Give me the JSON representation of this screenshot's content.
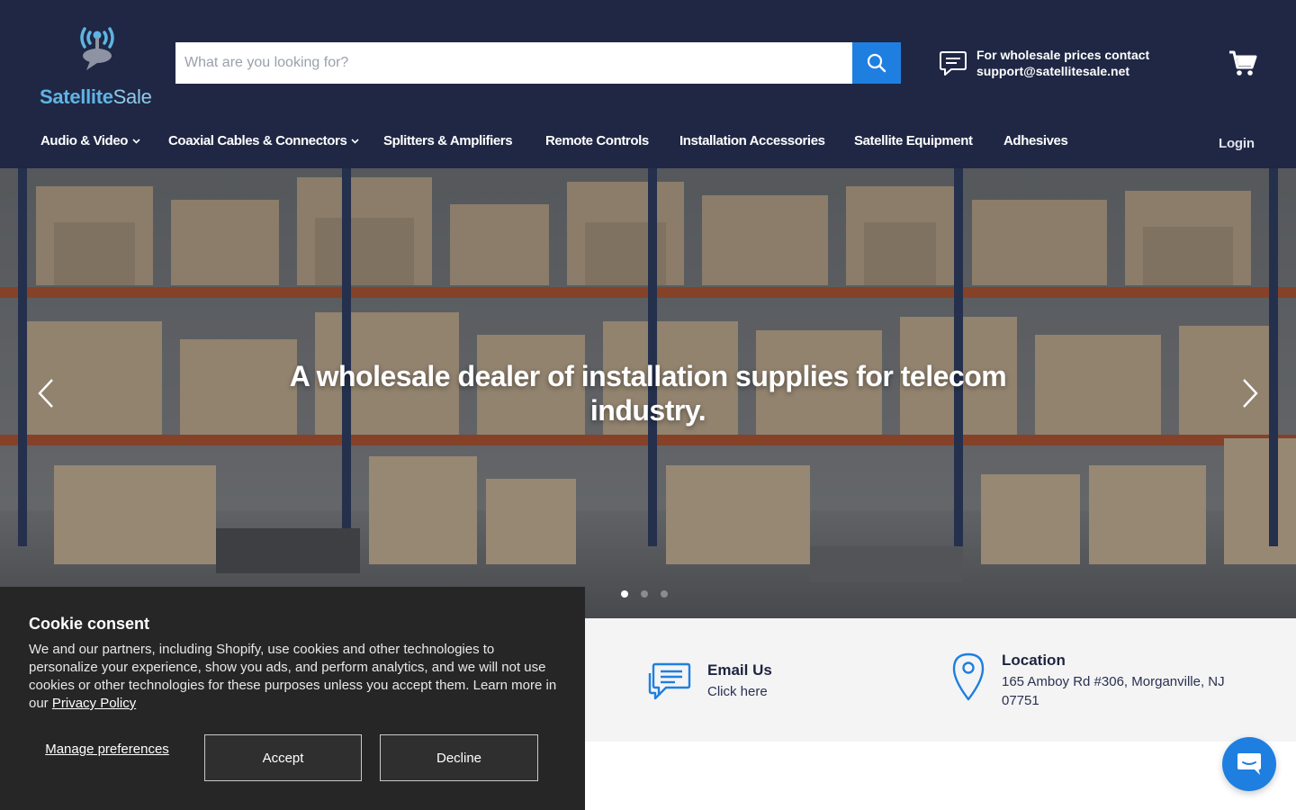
{
  "header": {
    "logo": {
      "brand_bold": "Satellite",
      "brand_light": "Sale"
    },
    "search": {
      "placeholder": "What are you looking for?",
      "value": ""
    },
    "contact": {
      "line1": "For wholesale prices contact",
      "line2": "support@satellitesale.net"
    },
    "login_label": "Login"
  },
  "nav": {
    "items": [
      {
        "label": "Audio & Video",
        "has_dropdown": true
      },
      {
        "label": "Coaxial Cables & Connectors",
        "has_dropdown": true
      },
      {
        "label": "Splitters & Amplifiers",
        "has_dropdown": false
      },
      {
        "label": "Remote Controls",
        "has_dropdown": false
      },
      {
        "label": "Installation Accessories",
        "has_dropdown": false
      },
      {
        "label": "Satellite Equipment",
        "has_dropdown": false
      },
      {
        "label": "Adhesives",
        "has_dropdown": false
      }
    ]
  },
  "hero": {
    "title": "A wholesale dealer of installation supplies for telecom industry.",
    "slide_count": 3,
    "active_slide": 1
  },
  "info": {
    "email": {
      "title": "Email Us",
      "subtitle": "Click here"
    },
    "location": {
      "title": "Location",
      "subtitle": "165 Amboy Rd #306, Morganville, NJ 07751"
    }
  },
  "cookie": {
    "title": "Cookie consent",
    "text": "We and our partners, including Shopify, use cookies and other technologies to personalize your experience, show you ads, and perform analytics, and we will not use cookies or other technologies for these purposes unless you accept them. Learn more in our ",
    "link_label": "Privacy Policy",
    "manage_label": "Manage preferences",
    "accept_label": "Accept",
    "decline_label": "Decline"
  },
  "colors": {
    "header_bg": "#1f2744",
    "accent": "#1f7fe0",
    "logo_blue": "#5fb4e3",
    "cookie_bg": "#262627",
    "info_bg": "#f4f4f5"
  },
  "icons": {
    "logo": "satellite-dish-chat-icon",
    "search": "search-icon",
    "contact": "chat-bubble-icon",
    "cart": "cart-icon",
    "email": "message-icon",
    "location": "map-pin-icon",
    "chat_widget": "chat-icon"
  }
}
